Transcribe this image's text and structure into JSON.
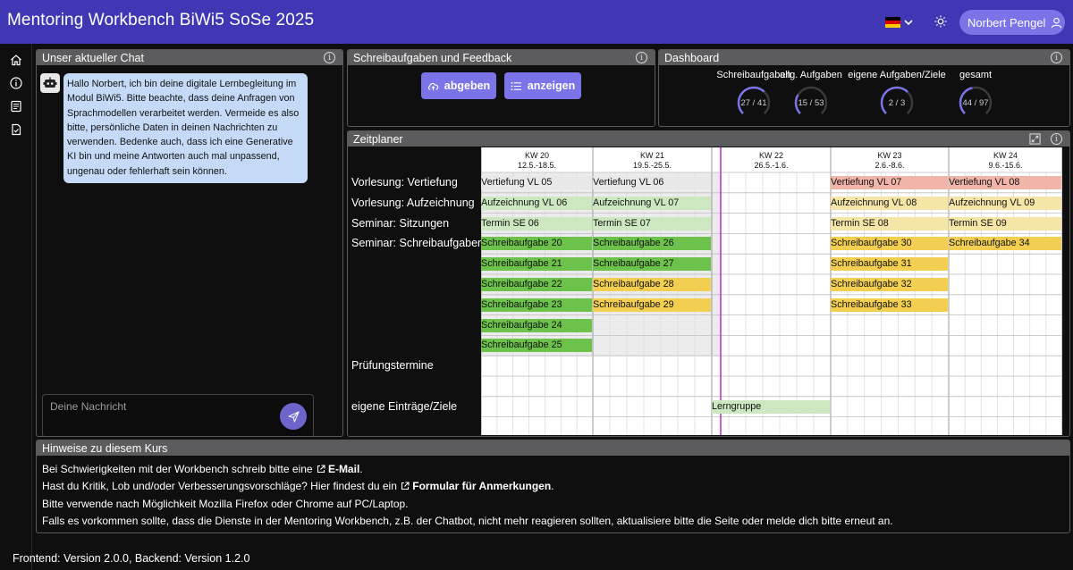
{
  "header": {
    "title": "Mentoring Workbench BiWi5 SoSe 2025",
    "user_name": "Norbert Pengel"
  },
  "rail": [
    "home-icon",
    "info-icon",
    "document-icon",
    "file-check-icon"
  ],
  "chat": {
    "title": "Unser aktueller Chat",
    "message": "Hallo Norbert, ich bin deine digitale Lernbegleitung im Modul BiWi5. Bitte beachte, dass deine Anfragen von Sprachmodellen verarbeitet werden. Vermeide es also bitte, persönliche Daten in deinen Nachrichten zu verwenden. Bedenke auch, dass ich eine Generative KI bin und meine Antworten auch mal unpassend, ungenau oder fehlerhaft sein können.",
    "placeholder": "Deine Nachricht"
  },
  "tasks": {
    "title": "Schreibaufgaben und Feedback",
    "submit_label": "abgeben",
    "show_label": "anzeigen"
  },
  "dashboard": {
    "title": "Dashboard",
    "gauges": [
      {
        "label": "Schreibaufgaben",
        "value": "27 / 41",
        "done": 27,
        "total": 41
      },
      {
        "label": "allg. Aufgaben",
        "value": "15 / 53",
        "done": 15,
        "total": 53
      },
      {
        "label": "eigene Aufgaben/Ziele",
        "value": "2 / 3",
        "done": 2,
        "total": 3
      },
      {
        "label": "gesamt",
        "value": "44 / 97",
        "done": 44,
        "total": 97
      }
    ]
  },
  "planner": {
    "title": "Zeitplaner",
    "weeks": [
      {
        "kw": "KW 20",
        "range": "12.5.-18.5."
      },
      {
        "kw": "KW 21",
        "range": "19.5.-25.5."
      },
      {
        "kw": "KW 22",
        "range": "26.5.-1.6."
      },
      {
        "kw": "KW 23",
        "range": "2.6.-8.6."
      },
      {
        "kw": "KW 24",
        "range": "9.6.-15.6."
      }
    ],
    "row_labels": [
      "Vorlesung: Vertiefung",
      "Vorlesung: Aufzeichnung",
      "Seminar: Sitzungen",
      "Seminar: Schreibaufgaben",
      "",
      "",
      "",
      "",
      "",
      "Prüfungstermine",
      "",
      "eigene Einträge/Ziele"
    ],
    "items": [
      {
        "label": "Vertiefung VL 05",
        "week": 0,
        "row": 0,
        "status": "neutral"
      },
      {
        "label": "Vertiefung VL 06",
        "week": 1,
        "row": 0,
        "status": "neutral"
      },
      {
        "label": "Vertiefung VL 07",
        "week": 3,
        "row": 0,
        "status": "overdue"
      },
      {
        "label": "Vertiefung VL 08",
        "week": 4,
        "row": 0,
        "status": "overdue"
      },
      {
        "label": "Aufzeichnung VL 06",
        "week": 0,
        "row": 1,
        "status": "done-light"
      },
      {
        "label": "Aufzeichnung VL 07",
        "week": 1,
        "row": 1,
        "status": "done-light"
      },
      {
        "label": "Aufzeichnung VL 08",
        "week": 3,
        "row": 1,
        "status": "open-light"
      },
      {
        "label": "Aufzeichnung VL 09",
        "week": 4,
        "row": 1,
        "status": "open-light"
      },
      {
        "label": "Termin SE 06",
        "week": 0,
        "row": 2,
        "status": "done-light"
      },
      {
        "label": "Termin SE 07",
        "week": 1,
        "row": 2,
        "status": "done-light"
      },
      {
        "label": "Termin SE 08",
        "week": 3,
        "row": 2,
        "status": "open-light"
      },
      {
        "label": "Termin SE 09",
        "week": 4,
        "row": 2,
        "status": "open-light"
      },
      {
        "label": "Schreibaufgabe 20",
        "week": 0,
        "row": 3,
        "status": "done"
      },
      {
        "label": "Schreibaufgabe 21",
        "week": 0,
        "row": 4,
        "status": "done"
      },
      {
        "label": "Schreibaufgabe 22",
        "week": 0,
        "row": 5,
        "status": "done"
      },
      {
        "label": "Schreibaufgabe 23",
        "week": 0,
        "row": 6,
        "status": "done"
      },
      {
        "label": "Schreibaufgabe 24",
        "week": 0,
        "row": 7,
        "status": "done"
      },
      {
        "label": "Schreibaufgabe 25",
        "week": 0,
        "row": 8,
        "status": "done"
      },
      {
        "label": "Schreibaufgabe 26",
        "week": 1,
        "row": 3,
        "status": "done"
      },
      {
        "label": "Schreibaufgabe 27",
        "week": 1,
        "row": 4,
        "status": "done"
      },
      {
        "label": "Schreibaufgabe 28",
        "week": 1,
        "row": 5,
        "status": "open"
      },
      {
        "label": "Schreibaufgabe 29",
        "week": 1,
        "row": 6,
        "status": "open"
      },
      {
        "label": "Schreibaufgabe 30",
        "week": 3,
        "row": 3,
        "status": "open"
      },
      {
        "label": "Schreibaufgabe 31",
        "week": 3,
        "row": 4,
        "status": "open"
      },
      {
        "label": "Schreibaufgabe 32",
        "week": 3,
        "row": 5,
        "status": "open"
      },
      {
        "label": "Schreibaufgabe 33",
        "week": 3,
        "row": 6,
        "status": "open"
      },
      {
        "label": "Schreibaufgabe 34",
        "week": 4,
        "row": 3,
        "status": "open"
      },
      {
        "label": "Lerngruppe",
        "week": 2,
        "row": 11,
        "status": "done-light"
      }
    ]
  },
  "hints": {
    "title": "Hinweise zu diesem Kurs",
    "line1_pre": "Bei Schwierigkeiten mit der Workbench schreib bitte eine",
    "line1_link": "E-Mail",
    "line1_post": ".",
    "line2_pre": "Hast du Kritik, Lob und/oder Verbesserungsvorschläge? Hier findest du ein",
    "line2_link": "Formular für Anmerkungen",
    "line2_post": ".",
    "line3": "Bitte verwende nach Möglichkeit Mozilla Firefox oder Chrome auf PC/Laptop.",
    "line4": "Falls es vorkommen sollte, dass die Dienste in der Mentoring Workbench, z.B. der Chatbot, nicht mehr reagieren sollten, aktualisiere bitte die Seite oder melde dich bitte erneut an."
  },
  "footer": {
    "text": "Frontend: Version 2.0.0, Backend: Version 1.2.0"
  },
  "colors": {
    "header": "#3f37b3",
    "accent": "#7b73e8",
    "done": "#6cc24a",
    "done_light": "#cde8c0",
    "open": "#f2cf50",
    "open_light": "#f5e6a8",
    "overdue": "#f0b5a8",
    "neutral": "#e8e8e8",
    "today_line": "#c026d3"
  }
}
